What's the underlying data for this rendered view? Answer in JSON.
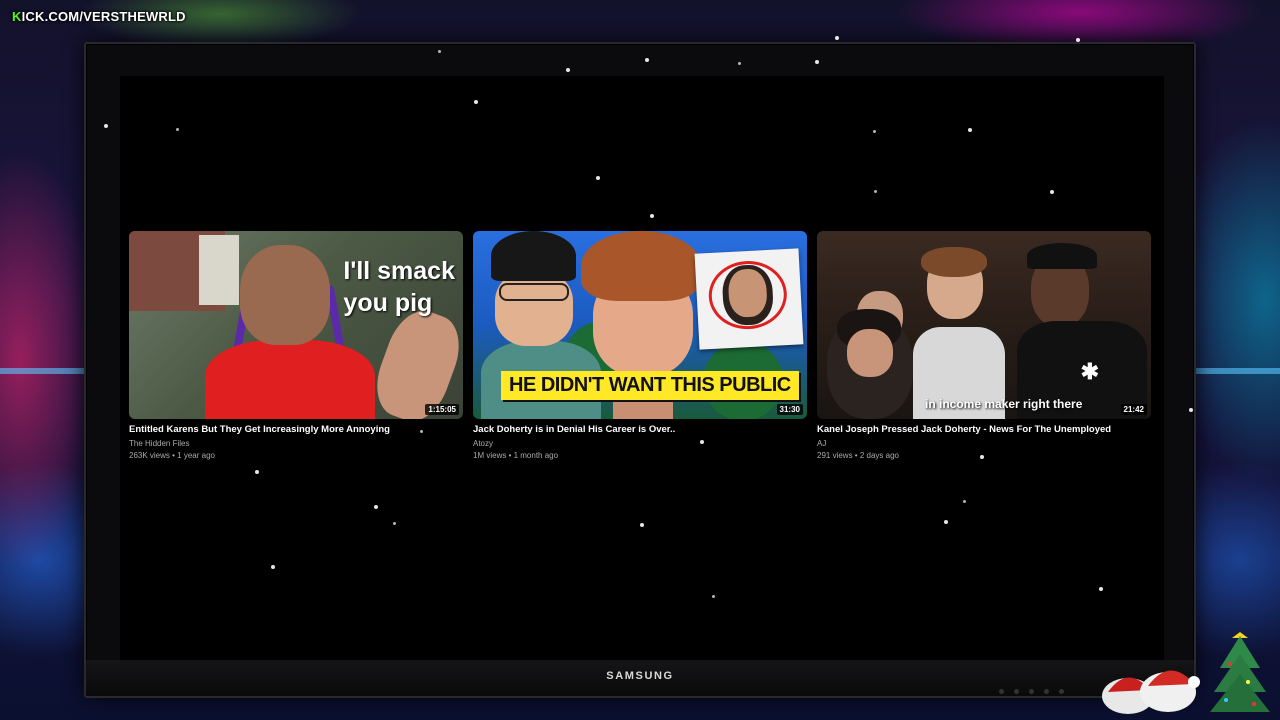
{
  "overlay": {
    "watermark_k": "K",
    "watermark_text": "ICK.COM/VERSTHEWRLD",
    "monitor_brand": "SAMSUNG"
  },
  "videos": [
    {
      "title": "Entitled Karens But They Get Increasingly More Annoying",
      "channel": "The Hidden Files",
      "meta": "263K views • 1 year ago",
      "duration": "1:15:05",
      "thumb_text": "I'll smack\nyou pig"
    },
    {
      "title": "Jack Doherty is in Denial His Career is Over..",
      "channel": "Atozy",
      "meta": "1M views • 1 month ago",
      "duration": "31:30",
      "thumb_text": "HE DIDN'T WANT THIS PUBLIC"
    },
    {
      "title": "Kanel Joseph Pressed Jack Doherty - News For The Unemployed",
      "channel": "AJ",
      "meta": "291 views • 2 days ago",
      "duration": "21:42",
      "thumb_text": "in income maker right there"
    }
  ],
  "colors": {
    "kick_green": "#53fc18",
    "banner_yellow": "#ffe927",
    "shirt_red": "#e02020"
  }
}
